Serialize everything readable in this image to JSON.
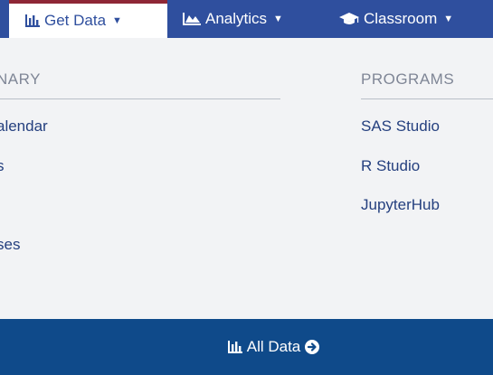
{
  "nav": {
    "get_data": {
      "label": "Get Data",
      "icon": "bar-chart-icon"
    },
    "analytics": {
      "label": "Analytics",
      "icon": "area-chart-icon"
    },
    "classroom": {
      "label": "Classroom",
      "icon": "graduation-cap-icon"
    }
  },
  "menu": {
    "left_heading": "NARY",
    "left_links": [
      "alendar",
      "s",
      "ses"
    ],
    "right_heading": "PROGRAMS",
    "right_links": [
      "SAS Studio",
      "R Studio",
      "JupyterHub"
    ]
  },
  "footer": {
    "label": "All Data",
    "icon": "arrow-circle-right-icon"
  },
  "colors": {
    "navbar": "#2f4f9e",
    "active_border": "#8e2736",
    "footer": "#0f4a8a",
    "link": "#25407f",
    "heading": "#7f8696",
    "panel": "#f2f3f5"
  }
}
